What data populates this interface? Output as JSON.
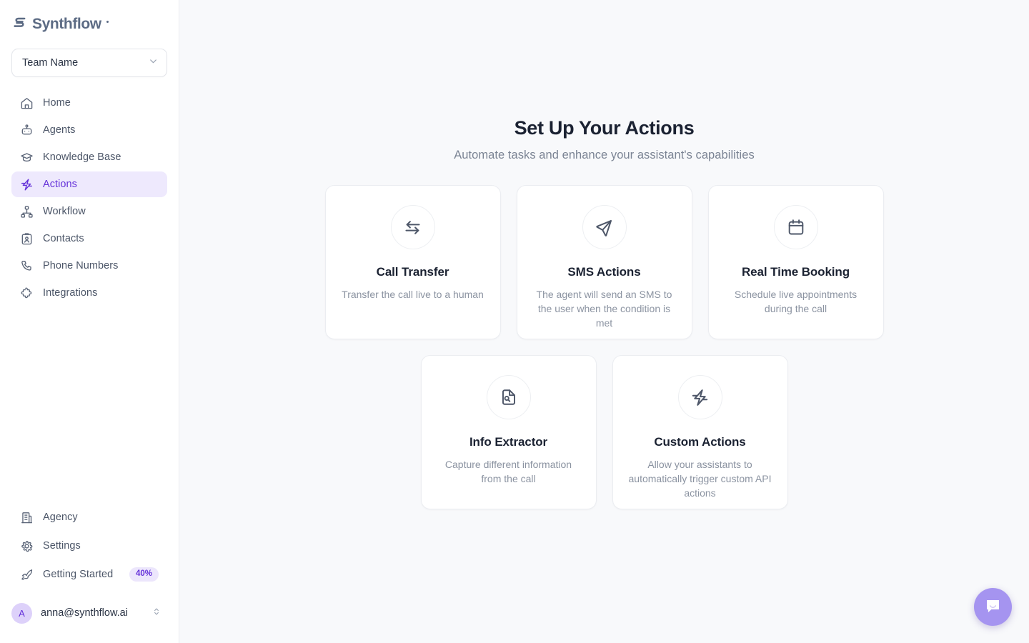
{
  "brand": {
    "name": "Synthflow",
    "logo_icon": "synthflow-s-mark",
    "accent_purple": "#6532d9",
    "accent_purple_bg": "#eee9fd",
    "logo_color": "#5c6b84"
  },
  "sidebar": {
    "team_selector": {
      "value": "Team Name",
      "icon": "chevron-down-icon"
    },
    "items": [
      {
        "label": "Home",
        "icon": "home-icon",
        "active": false
      },
      {
        "label": "Agents",
        "icon": "agent-robot-icon",
        "active": false
      },
      {
        "label": "Knowledge Base",
        "icon": "graduation-cap-icon",
        "active": false
      },
      {
        "label": "Actions",
        "icon": "lightning-bolt-icon",
        "active": true
      },
      {
        "label": "Workflow",
        "icon": "workflow-nodes-icon",
        "active": false
      },
      {
        "label": "Contacts",
        "icon": "contact-card-icon",
        "active": false
      },
      {
        "label": "Phone Numbers",
        "icon": "phone-icon",
        "active": false
      },
      {
        "label": "Integrations",
        "icon": "puzzle-piece-icon",
        "active": false
      }
    ],
    "bottom_items": [
      {
        "label": "Agency",
        "icon": "building-icon",
        "badge": null
      },
      {
        "label": "Settings",
        "icon": "gear-icon",
        "badge": null
      },
      {
        "label": "Getting Started",
        "icon": "rocket-icon",
        "badge": "40%"
      }
    ],
    "user": {
      "avatar_initial": "A",
      "email": "anna@synthflow.ai",
      "icon": "chevron-up-down-icon"
    }
  },
  "main": {
    "title": "Set Up Your Actions",
    "subtitle": "Automate tasks and enhance your assistant's capabilities",
    "cards": [
      {
        "title": "Call Transfer",
        "description": "Transfer the call live to a human",
        "icon": "arrow-left-right-icon"
      },
      {
        "title": "SMS Actions",
        "description": "The agent will send an SMS to the user when the condition is met",
        "icon": "send-paper-plane-icon"
      },
      {
        "title": "Real Time Booking",
        "description": "Schedule live appointments during the call",
        "icon": "calendar-icon"
      },
      {
        "title": "Info Extractor",
        "description": "Capture different information from the call",
        "icon": "file-search-icon"
      },
      {
        "title": "Custom Actions",
        "description": "Allow your assistants to automatically trigger custom API actions",
        "icon": "lightning-bolt-icon"
      }
    ]
  },
  "chat_widget": {
    "icon": "chat-bubble-smile-icon",
    "color": "#a594f0"
  }
}
